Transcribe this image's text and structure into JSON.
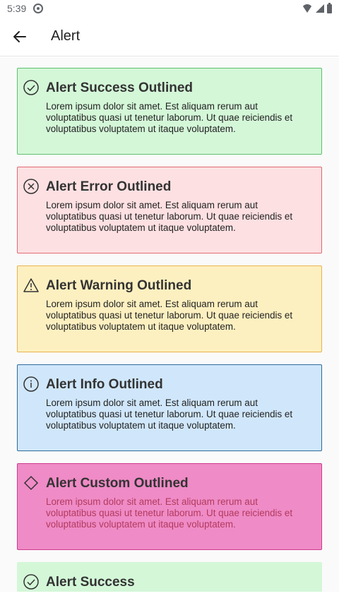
{
  "status": {
    "time": "5:39"
  },
  "app_bar": {
    "title": "Alert"
  },
  "alerts": [
    {
      "title": "Alert Success Outlined",
      "body": "Lorem ipsum dolor sit amet. Est aliquam rerum aut voluptatibus quasi ut tenetur laborum. Ut quae reiciendis et voluptatibus voluptatem ut itaque voluptatem.",
      "icon": "check-circle-icon"
    },
    {
      "title": "Alert Error Outlined",
      "body": "Lorem ipsum dolor sit amet. Est aliquam rerum aut voluptatibus quasi ut tenetur laborum. Ut quae reiciendis et voluptatibus voluptatem ut itaque voluptatem.",
      "icon": "close-circle-icon"
    },
    {
      "title": "Alert Warning Outlined",
      "body": "Lorem ipsum dolor sit amet. Est aliquam rerum aut voluptatibus quasi ut tenetur laborum. Ut quae reiciendis et voluptatibus voluptatem ut itaque voluptatem.",
      "icon": "warning-icon"
    },
    {
      "title": "Alert Info Outlined",
      "body": "Lorem ipsum dolor sit amet. Est aliquam rerum aut voluptatibus quasi ut tenetur laborum. Ut quae reiciendis et voluptatibus voluptatem ut itaque voluptatem.",
      "icon": "info-icon"
    },
    {
      "title": "Alert Custom Outlined",
      "body": "Lorem ipsum dolor sit amet. Est aliquam rerum aut voluptatibus quasi ut tenetur laborum. Ut quae reiciendis et voluptatibus voluptatem ut itaque voluptatem.",
      "icon": "diamond-icon"
    },
    {
      "title": "Alert Success",
      "icon": "check-circle-icon"
    }
  ],
  "colors": {
    "success_bg": "#d4f7d8",
    "success_border": "#5fbf70",
    "error_bg": "#fde0e2",
    "error_border": "#e06a76",
    "warning_bg": "#fdf0c0",
    "warning_border": "#e9b24c",
    "info_bg": "#d0e7fb",
    "info_border": "#2f6a9a",
    "custom_bg": "#ef8bc6",
    "custom_border": "#cf3a8d"
  }
}
